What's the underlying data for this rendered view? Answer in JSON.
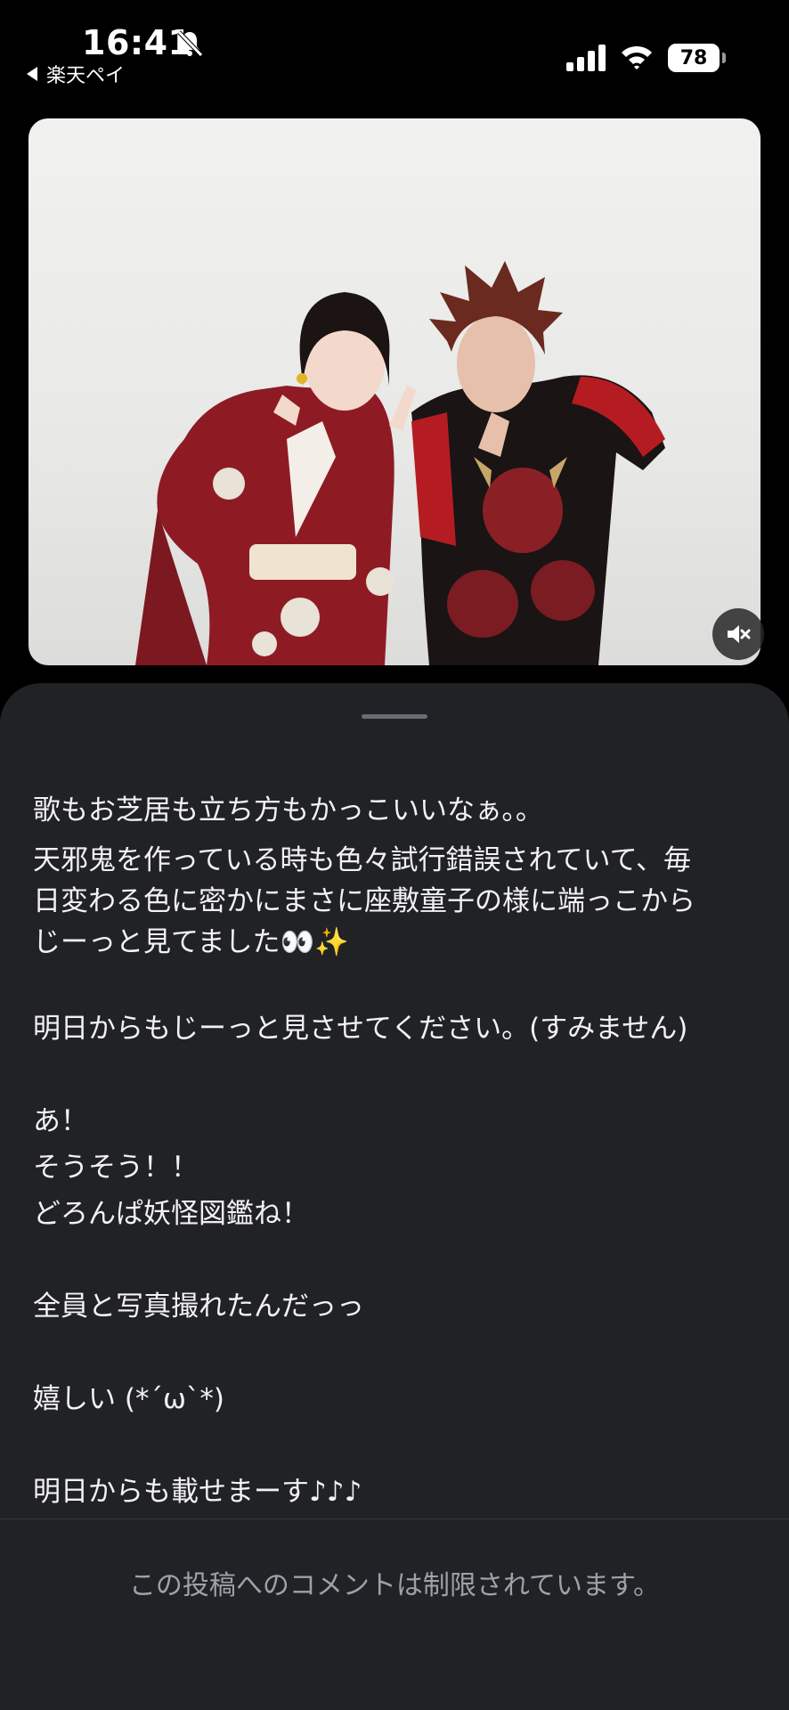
{
  "status_bar": {
    "time": "16:41",
    "back_label": "楽天ペイ",
    "battery": "78",
    "icons": [
      "bell-slash-icon",
      "back-arrow-icon",
      "signal-icon",
      "wifi-icon",
      "battery-icon"
    ]
  },
  "media": {
    "mute_icon": "speaker-muted-icon"
  },
  "post": {
    "lines": [
      "歌もお芝居も立ち方もかっこいいなぁ。。",
      "天邪鬼を作っている時も色々試行錯誤されていて、毎",
      "日変わる色に密かにまさに座敷童子の様に端っこから",
      "じーっと見てました👀✨",
      "明日からもじーっと見させてください。(すみません)",
      "あ！",
      "そうそう！！",
      "どろんぱ妖怪図鑑ね！",
      "全員と写真撮れたんだっっ",
      "嬉しい (*´ω`*)",
      "明日からも載せまーす♪♪♪"
    ]
  },
  "footer": {
    "comment_notice": "この投稿へのコメントは制限されています。"
  },
  "colors": {
    "background": "#000000",
    "sheet": "#212226",
    "footer_text": "#9ea1a7"
  }
}
